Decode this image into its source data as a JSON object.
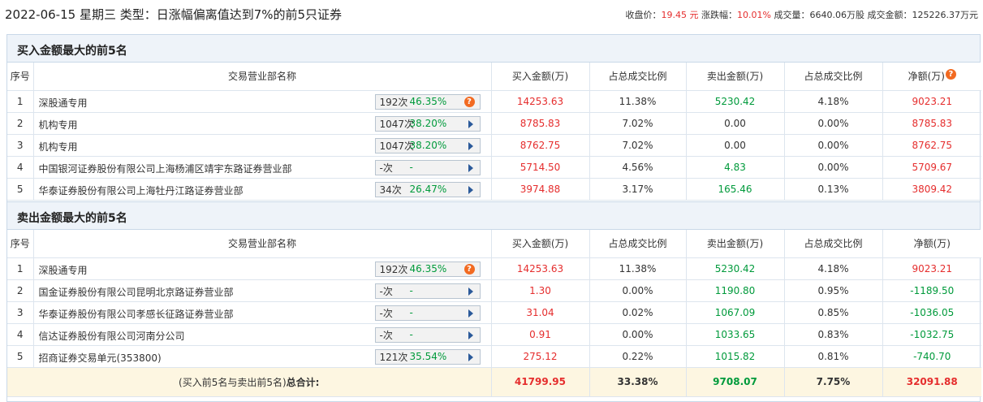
{
  "header": {
    "title": "2022-06-15 星期三 类型：日涨幅偏离值达到7%的前5只证券",
    "close_label": "收盘价：",
    "close_value": "19.45 元",
    "change_label": "涨跌幅：",
    "change_value": "10.01%",
    "volume_label": "成交量：",
    "volume_value": "6640.06万股",
    "amount_label": "成交金额：",
    "amount_value": "125226.37万元"
  },
  "columns": {
    "idx": "序号",
    "name": "交易营业部名称",
    "buy": "买入金额(万)",
    "buy_ratio": "占总成交比例",
    "sell": "卖出金额(万)",
    "sell_ratio": "占总成交比例",
    "net": "净额(万)"
  },
  "colors": {
    "red": "#e52d2d",
    "green": "#009a3b",
    "header_bg": "#eef3f9",
    "total_bg": "#fdf6e1"
  },
  "buy_section": {
    "title": "买入金额最大的前5名",
    "rows": [
      {
        "idx": "1",
        "name": "深股通专用",
        "count": "192次",
        "pct": "46.35%",
        "icon": "help-icon",
        "buy": "14253.63",
        "buy_ratio": "11.38%",
        "sell": "5230.42",
        "sell_ratio": "4.18%",
        "net": "9023.21"
      },
      {
        "idx": "2",
        "name": "机构专用",
        "count": "1047次",
        "pct": "38.20%",
        "icon": "arrow-right-icon",
        "buy": "8785.83",
        "buy_ratio": "7.02%",
        "sell": "0.00",
        "sell_ratio": "0.00%",
        "net": "8785.83"
      },
      {
        "idx": "3",
        "name": "机构专用",
        "count": "1047次",
        "pct": "38.20%",
        "icon": "arrow-right-icon",
        "buy": "8762.75",
        "buy_ratio": "7.02%",
        "sell": "0.00",
        "sell_ratio": "0.00%",
        "net": "8762.75"
      },
      {
        "idx": "4",
        "name": "中国银河证券股份有限公司上海杨浦区靖宇东路证券营业部",
        "count": "-次",
        "pct": "-",
        "icon": "arrow-right-icon",
        "buy": "5714.50",
        "buy_ratio": "4.56%",
        "sell": "4.83",
        "sell_ratio": "0.00%",
        "net": "5709.67"
      },
      {
        "idx": "5",
        "name": "华泰证券股份有限公司上海牡丹江路证券营业部",
        "count": "34次",
        "pct": "26.47%",
        "icon": "arrow-right-icon",
        "buy": "3974.88",
        "buy_ratio": "3.17%",
        "sell": "165.46",
        "sell_ratio": "0.13%",
        "net": "3809.42"
      }
    ]
  },
  "sell_section": {
    "title": "卖出金额最大的前5名",
    "rows": [
      {
        "idx": "1",
        "name": "深股通专用",
        "count": "192次",
        "pct": "46.35%",
        "icon": "help-icon",
        "buy": "14253.63",
        "buy_ratio": "11.38%",
        "sell": "5230.42",
        "sell_ratio": "4.18%",
        "net": "9023.21"
      },
      {
        "idx": "2",
        "name": "国金证券股份有限公司昆明北京路证券营业部",
        "count": "-次",
        "pct": "-",
        "icon": "arrow-right-icon",
        "buy": "1.30",
        "buy_ratio": "0.00%",
        "sell": "1190.80",
        "sell_ratio": "0.95%",
        "net": "-1189.50"
      },
      {
        "idx": "3",
        "name": "华泰证券股份有限公司孝感长征路证券营业部",
        "count": "-次",
        "pct": "-",
        "icon": "arrow-right-icon",
        "buy": "31.04",
        "buy_ratio": "0.02%",
        "sell": "1067.09",
        "sell_ratio": "0.85%",
        "net": "-1036.05"
      },
      {
        "idx": "4",
        "name": "信达证券股份有限公司河南分公司",
        "count": "-次",
        "pct": "-",
        "icon": "arrow-right-icon",
        "buy": "0.91",
        "buy_ratio": "0.00%",
        "sell": "1033.65",
        "sell_ratio": "0.83%",
        "net": "-1032.75"
      },
      {
        "idx": "5",
        "name": "招商证券交易单元(353800)",
        "count": "121次",
        "pct": "35.54%",
        "icon": "arrow-right-icon",
        "buy": "275.12",
        "buy_ratio": "0.22%",
        "sell": "1015.82",
        "sell_ratio": "0.81%",
        "net": "-740.70"
      }
    ],
    "total": {
      "label_prefix": "(买入前5名与卖出前5名)",
      "label_bold": "总合计:",
      "buy": "41799.95",
      "buy_ratio": "33.38%",
      "sell": "9708.07",
      "sell_ratio": "7.75%",
      "net": "32091.88"
    }
  }
}
